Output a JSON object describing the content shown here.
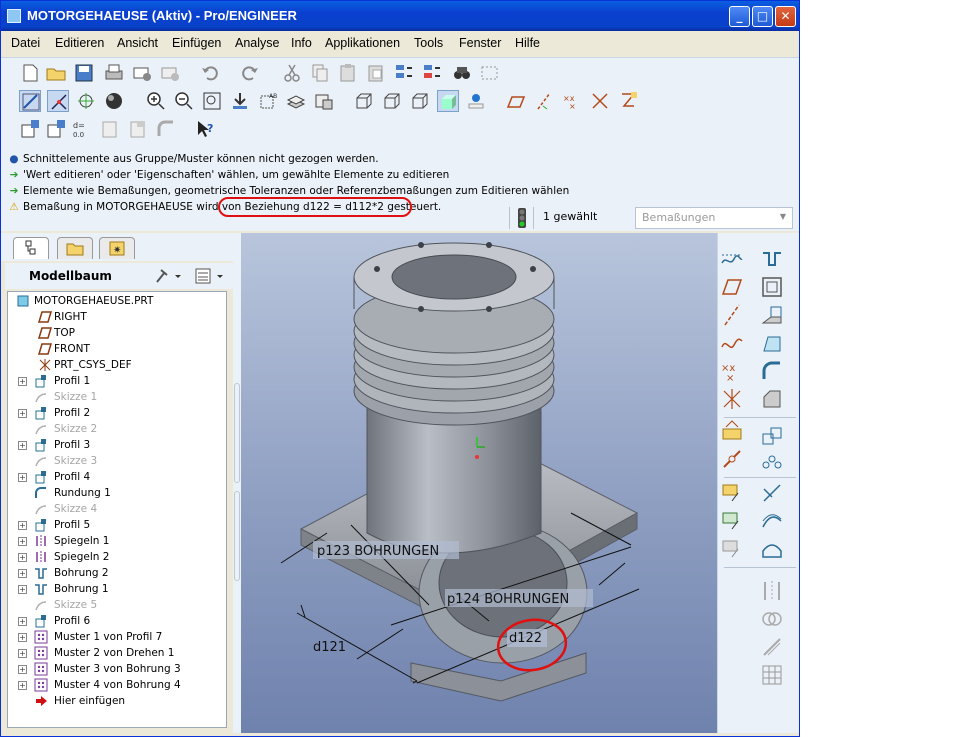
{
  "window": {
    "title": "MOTORGEHAEUSE (Aktiv) - Pro/ENGINEER",
    "btn_min": "_",
    "btn_max": "□",
    "btn_close": "✕"
  },
  "menu": [
    {
      "label": "Datei"
    },
    {
      "label": "Editieren"
    },
    {
      "label": "Ansicht"
    },
    {
      "label": "Einfügen"
    },
    {
      "label": "Analyse"
    },
    {
      "label": "Info"
    },
    {
      "label": "Applikationen"
    },
    {
      "label": "Tools"
    },
    {
      "label": "Fenster"
    },
    {
      "label": "Hilfe"
    }
  ],
  "messages": [
    {
      "icon": "info-dot-icon",
      "text": "Schnittelemente aus Gruppe/Muster können nicht gezogen werden."
    },
    {
      "icon": "arrow-right-icon",
      "text": "'Wert editieren' oder 'Eigenschaften' wählen, um gewählte Elemente zu editieren"
    },
    {
      "icon": "arrow-right-icon",
      "text": "Elemente wie Bemaßungen, geometrische Toleranzen oder Referenzbemaßungen zum Editieren wählen"
    },
    {
      "icon": "warning-icon",
      "text": "Bemaßung in MOTORGEHAEUSE wird von Beziehung d122 = d112*2 gesteuert."
    }
  ],
  "status": {
    "selected_count": "1 gewählt",
    "filter_value": "Bemaßungen"
  },
  "model_tree": {
    "title": "Modellbaum",
    "items": [
      {
        "label": "MOTORGEHAEUSE.PRT",
        "icon": "part-icon",
        "suppressed": false,
        "expandable": false
      },
      {
        "label": "RIGHT",
        "icon": "datum-plane-icon",
        "suppressed": false,
        "expandable": false
      },
      {
        "label": "TOP",
        "icon": "datum-plane-icon",
        "suppressed": false,
        "expandable": false
      },
      {
        "label": "FRONT",
        "icon": "datum-plane-icon",
        "suppressed": false,
        "expandable": false
      },
      {
        "label": "PRT_CSYS_DEF",
        "icon": "coordinate-system-icon",
        "suppressed": false,
        "expandable": false
      },
      {
        "label": "Profil 1",
        "icon": "extrude-icon",
        "suppressed": false,
        "expandable": true
      },
      {
        "label": "Skizze 1",
        "icon": "sketch-icon",
        "suppressed": true,
        "expandable": false
      },
      {
        "label": "Profil 2",
        "icon": "extrude-icon",
        "suppressed": false,
        "expandable": true
      },
      {
        "label": "Skizze 2",
        "icon": "sketch-icon",
        "suppressed": true,
        "expandable": false
      },
      {
        "label": "Profil 3",
        "icon": "extrude-icon",
        "suppressed": false,
        "expandable": true
      },
      {
        "label": "Skizze 3",
        "icon": "sketch-icon",
        "suppressed": true,
        "expandable": false
      },
      {
        "label": "Profil 4",
        "icon": "extrude-icon",
        "suppressed": false,
        "expandable": true
      },
      {
        "label": "Rundung 1",
        "icon": "round-icon",
        "suppressed": false,
        "expandable": false
      },
      {
        "label": "Skizze 4",
        "icon": "sketch-icon",
        "suppressed": true,
        "expandable": false
      },
      {
        "label": "Profil 5",
        "icon": "extrude-icon",
        "suppressed": false,
        "expandable": true
      },
      {
        "label": "Spiegeln 1",
        "icon": "mirror-icon",
        "suppressed": false,
        "expandable": true
      },
      {
        "label": "Spiegeln 2",
        "icon": "mirror-icon",
        "suppressed": false,
        "expandable": true
      },
      {
        "label": "Bohrung 2",
        "icon": "hole-icon",
        "suppressed": false,
        "expandable": true
      },
      {
        "label": "Bohrung 1",
        "icon": "hole-icon",
        "suppressed": false,
        "expandable": true
      },
      {
        "label": "Skizze 5",
        "icon": "sketch-icon",
        "suppressed": true,
        "expandable": false
      },
      {
        "label": "Profil 6",
        "icon": "extrude-icon",
        "suppressed": false,
        "expandable": true
      },
      {
        "label": "Muster 1 von Profil 7",
        "icon": "pattern-icon",
        "suppressed": false,
        "expandable": true
      },
      {
        "label": "Muster 2 von Drehen 1",
        "icon": "pattern-icon",
        "suppressed": false,
        "expandable": true
      },
      {
        "label": "Muster 3 von Bohrung 3",
        "icon": "pattern-icon",
        "suppressed": false,
        "expandable": true
      },
      {
        "label": "Muster 4 von Bohrung 4",
        "icon": "pattern-icon",
        "suppressed": false,
        "expandable": true
      },
      {
        "label": "Hier einfügen",
        "icon": "insert-here-arrow-icon",
        "suppressed": false,
        "expandable": false
      }
    ]
  },
  "viewport": {
    "dimensions": [
      {
        "id": "p123",
        "text": "p123  BOHRUNGEN"
      },
      {
        "id": "p124",
        "text": "p124 BOHRUNGEN"
      },
      {
        "id": "d121",
        "text": "d121"
      },
      {
        "id": "d122",
        "text": "d122"
      }
    ],
    "annotation_color": "#e01010"
  }
}
